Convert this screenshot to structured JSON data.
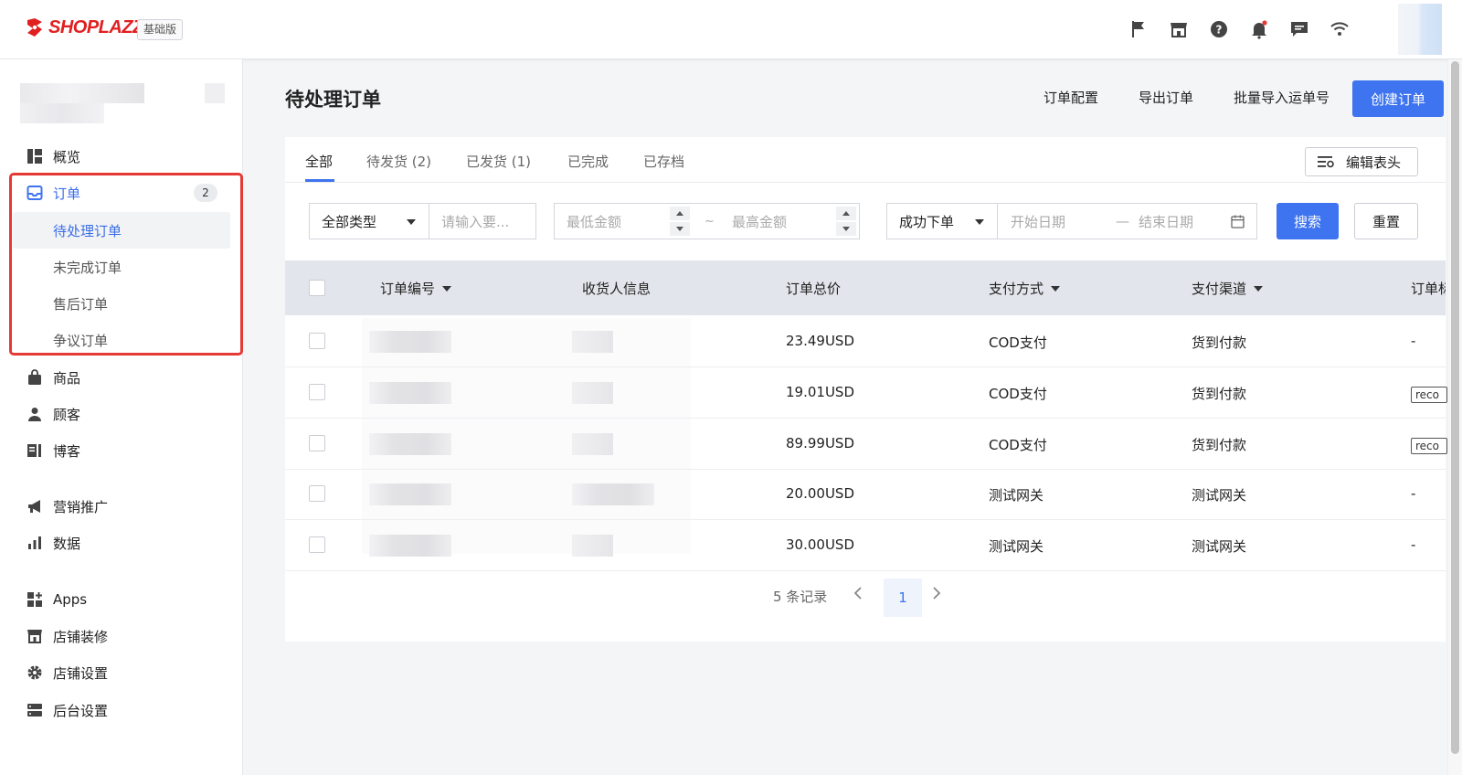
{
  "app": {
    "brand": "SHOPLAZZA",
    "plan": "基础版"
  },
  "topbar": {
    "icons": [
      "flag-icon",
      "store-icon",
      "help-icon",
      "bell-icon",
      "chat-icon",
      "wifi-icon"
    ]
  },
  "sidebar": {
    "items": [
      {
        "label": "概览",
        "icon": "dashboard-icon"
      },
      {
        "label": "订单",
        "icon": "inbox-icon",
        "badge": "2"
      },
      {
        "label": "待处理订单"
      },
      {
        "label": "未完成订单"
      },
      {
        "label": "售后订单"
      },
      {
        "label": "争议订单"
      },
      {
        "label": "商品",
        "icon": "bag-icon"
      },
      {
        "label": "顾客",
        "icon": "person-icon"
      },
      {
        "label": "博客",
        "icon": "blog-icon"
      },
      {
        "label": "营销推广",
        "icon": "megaphone-icon"
      },
      {
        "label": "数据",
        "icon": "bar-chart-icon"
      },
      {
        "label": "Apps",
        "icon": "apps-icon"
      },
      {
        "label": "店铺装修",
        "icon": "store-icon"
      },
      {
        "label": "店铺设置",
        "icon": "gear-icon"
      },
      {
        "label": "后台设置",
        "icon": "server-icon"
      }
    ]
  },
  "header": {
    "title": "待处理订单",
    "actions": [
      "订单配置",
      "导出订单",
      "批量导入运单号"
    ],
    "create_label": "创建订单"
  },
  "tabs": [
    "全部",
    "待发货 (2)",
    "已发货 (1)",
    "已完成",
    "已存档"
  ],
  "edit_header_label": "编辑表头",
  "filters": {
    "type_select": "全部类型",
    "keyword_placeholder": "请输入要...",
    "min_amount_placeholder": "最低金额",
    "range_sep": "~",
    "max_amount_placeholder": "最高金额",
    "status_select": "成功下单",
    "start_date_placeholder": "开始日期",
    "date_sep": "—",
    "end_date_placeholder": "结束日期",
    "search_label": "搜索",
    "reset_label": "重置"
  },
  "table": {
    "columns": [
      "订单编号",
      "收货人信息",
      "订单总价",
      "支付方式",
      "支付渠道",
      "订单标"
    ],
    "rows": [
      {
        "total": "23.49USD",
        "payment": "COD支付",
        "channel": "货到付款",
        "tag": "-"
      },
      {
        "total": "19.01USD",
        "payment": "COD支付",
        "channel": "货到付款",
        "tag": "reco"
      },
      {
        "total": "89.99USD",
        "payment": "COD支付",
        "channel": "货到付款",
        "tag": "reco"
      },
      {
        "total": "20.00USD",
        "payment": "测试网关",
        "channel": "测试网关",
        "tag": "-"
      },
      {
        "total": "30.00USD",
        "payment": "测试网关",
        "channel": "测试网关",
        "tag": "-"
      }
    ]
  },
  "pagination": {
    "total_text": "5 条记录",
    "current": "1"
  },
  "colors": {
    "accent": "#3e74ef",
    "highlight": "#e53935",
    "brand": "#e02020"
  }
}
